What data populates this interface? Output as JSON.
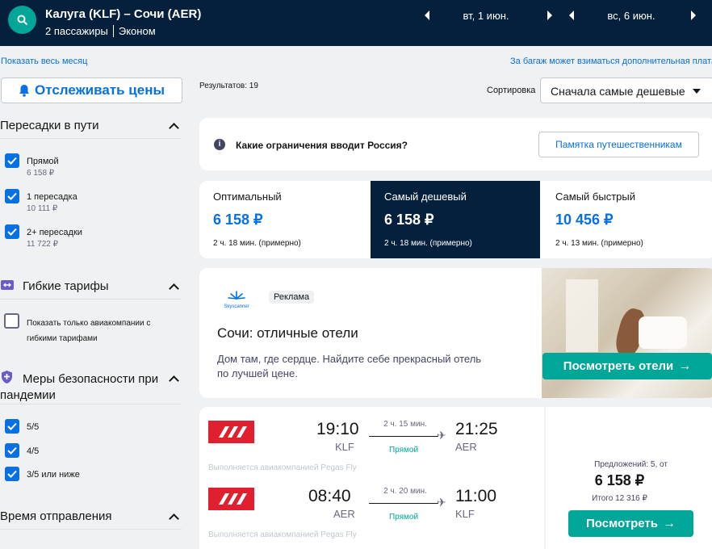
{
  "header": {
    "route": "Калуга (KLF) – Сочи (AER)",
    "passengers": "2 пассажиры",
    "cabin": "Эконом",
    "depart_date": "вт, 1 июн.",
    "return_date": "вс, 6 июн."
  },
  "links": {
    "show_month": "Показать весь месяц",
    "baggage_note": "За багаж может взиматься дополнительная плата"
  },
  "sidebar": {
    "track_label": "Отслеживать цены",
    "stops_title": "Пересадки в пути",
    "stops": [
      {
        "label": "Прямой",
        "price": "6 158 ₽",
        "checked": true
      },
      {
        "label": "1 пересадка",
        "price": "10 111 ₽",
        "checked": true
      },
      {
        "label": "2+ пересадки",
        "price": "11 722 ₽",
        "checked": true
      }
    ],
    "flex_title": "Гибкие тарифы",
    "flex_option_line1": "Показать только авиакомпании с",
    "flex_option_line2": "гибкими тарифами",
    "safety_title_line1": "Меры безопасности при",
    "safety_title_line2": "пандемии",
    "safety": [
      {
        "label": "5/5",
        "checked": true
      },
      {
        "label": "4/5",
        "checked": true
      },
      {
        "label": "3/5 или ниже",
        "checked": true
      }
    ],
    "departure_title": "Время отправления"
  },
  "results": {
    "count": "Результатов: 19",
    "sort_label": "Сортировка",
    "sort_value": "Сначала самые дешевые"
  },
  "notice": {
    "text": "Какие ограничения вводит Россия?",
    "button": "Памятка путешественникам"
  },
  "tabs": [
    {
      "title": "Оптимальный",
      "price": "6 158 ₽",
      "duration": "2 ч. 18 мин. (примерно)"
    },
    {
      "title": "Самый дешевый",
      "price": "6 158 ₽",
      "duration": "2 ч. 18 мин. (примерно)"
    },
    {
      "title": "Самый быстрый",
      "price": "10 456 ₽",
      "duration": "2 ч. 13 мин. (примерно)"
    }
  ],
  "ad": {
    "brand": "Skyscanner",
    "badge": "Реклама",
    "title": "Сочи: отличные отели",
    "body_line1": "Дом там, где сердце. Найдите себе прекрасный отель",
    "body_line2": "по лучшей цене.",
    "button": "Посмотреть отели"
  },
  "flight": {
    "legs": [
      {
        "dep_time": "19:10",
        "dep_code": "KLF",
        "duration": "2 ч. 15 мин.",
        "stops": "Прямой",
        "arr_time": "21:25",
        "arr_code": "AER",
        "operator": "Выполняется авиакомпанией Pegas Fly"
      },
      {
        "dep_time": "08:40",
        "dep_code": "AER",
        "duration": "2 ч. 20 мин.",
        "stops": "Прямой",
        "arr_time": "11:00",
        "arr_code": "KLF",
        "operator": "Выполняется авиакомпанией Pegas Fly"
      }
    ],
    "offers": "Предложений: 5, от",
    "price": "6 158 ₽",
    "total": "Итого 12 316 ₽",
    "button": "Посмотреть"
  },
  "colors": {
    "header_bg": "#05203c",
    "accent_blue": "#0770e3",
    "accent_green": "#00a698",
    "airline_red": "#e0202e"
  }
}
